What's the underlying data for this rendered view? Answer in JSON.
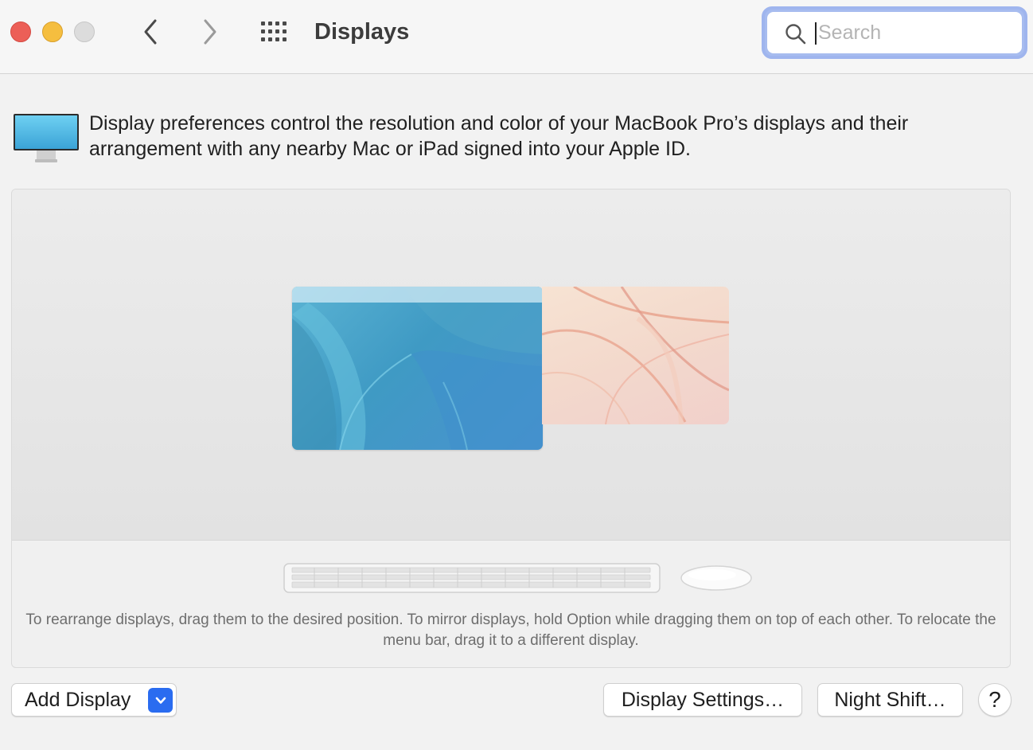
{
  "window": {
    "title": "Displays",
    "controls": [
      "close",
      "minimize",
      "zoom"
    ]
  },
  "toolbar": {
    "back_icon": "chevron-left-icon",
    "forward_icon": "chevron-right-icon",
    "show_all_icon": "grid-icon"
  },
  "search": {
    "placeholder": "Search",
    "value": ""
  },
  "description": {
    "icon": "display-icon",
    "text": "Display preferences control the resolution and color of your MacBook Pro’s displays and their arrangement with any nearby Mac or iPad signed into your Apple ID."
  },
  "arrangement": {
    "displays": [
      {
        "role": "main",
        "has_menu_bar": true,
        "wallpaper_colors": [
          "#5ab3d3",
          "#3f9ac4",
          "#4a92cf"
        ]
      },
      {
        "role": "secondary",
        "has_menu_bar": false,
        "wallpaper_colors": [
          "#f7e3d3",
          "#f3d9cc",
          "#e9a48f"
        ]
      }
    ],
    "peripherals": [
      "keyboard-icon",
      "mouse-icon"
    ],
    "hint": "To rearrange displays, drag them to the desired position. To mirror displays, hold Option while dragging them on top of each other. To relocate the menu bar, drag it to a different display."
  },
  "buttons": {
    "add_display": "Add Display",
    "display_settings": "Display Settings…",
    "night_shift": "Night Shift…",
    "help": "?"
  },
  "colors": {
    "close": "#ec5f57",
    "minimize": "#f5be3f",
    "zoom_disabled": "#dcdcdc",
    "accent": "#2a6cf0",
    "focus_ring": "#9fb5ee"
  }
}
